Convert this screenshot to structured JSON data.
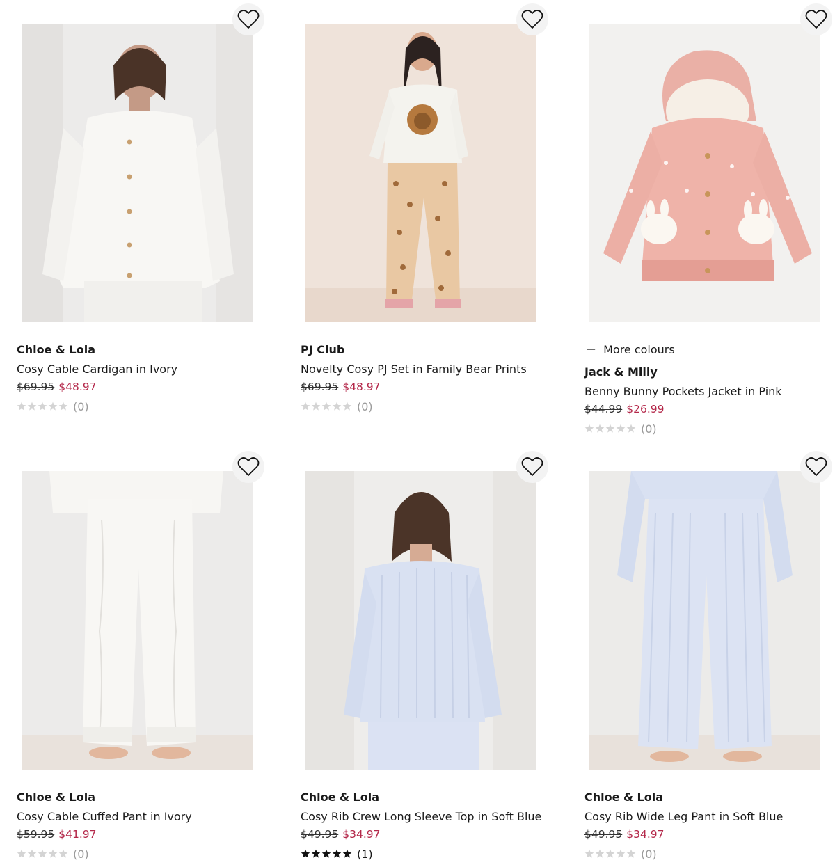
{
  "products": [
    {
      "brand": "Chloe & Lola",
      "title": "Cosy Cable Cardigan in Ivory",
      "was_price": "$69.95",
      "price": "$48.97",
      "review_count": "(0)",
      "rating": 0,
      "more_colours": "",
      "image": "cable-cardigan-ivory"
    },
    {
      "brand": "PJ Club",
      "title": "Novelty Cosy PJ Set in Family Bear Prints",
      "was_price": "$69.95",
      "price": "$48.97",
      "review_count": "(0)",
      "rating": 0,
      "more_colours": "",
      "image": "bear-pj-set"
    },
    {
      "brand": "Jack & Milly",
      "title": "Benny Bunny Pockets Jacket in Pink",
      "was_price": "$44.99",
      "price": "$26.99",
      "review_count": "(0)",
      "rating": 0,
      "more_colours": "More colours",
      "image": "bunny-jacket-pink"
    },
    {
      "brand": "Chloe & Lola",
      "title": "Cosy Cable Cuffed Pant in Ivory",
      "was_price": "$59.95",
      "price": "$41.97",
      "review_count": "(0)",
      "rating": 0,
      "more_colours": "",
      "image": "cable-pant-ivory"
    },
    {
      "brand": "Chloe & Lola",
      "title": "Cosy Rib Crew Long Sleeve Top in Soft Blue",
      "was_price": "$49.95",
      "price": "$34.97",
      "review_count": "(1)",
      "rating": 5,
      "more_colours": "",
      "image": "rib-top-blue"
    },
    {
      "brand": "Chloe & Lola",
      "title": "Cosy Rib Wide Leg Pant in Soft Blue",
      "was_price": "$49.95",
      "price": "$34.97",
      "review_count": "(0)",
      "rating": 0,
      "more_colours": "",
      "image": "rib-pant-blue"
    }
  ],
  "colors": {
    "sale_price": "#b4284a",
    "star_empty": "#d4d4d4",
    "star_filled": "#111111"
  },
  "icons": {
    "wishlist": "heart-outline-icon",
    "more_colours": "plus-icon",
    "rating": "star-icon"
  }
}
